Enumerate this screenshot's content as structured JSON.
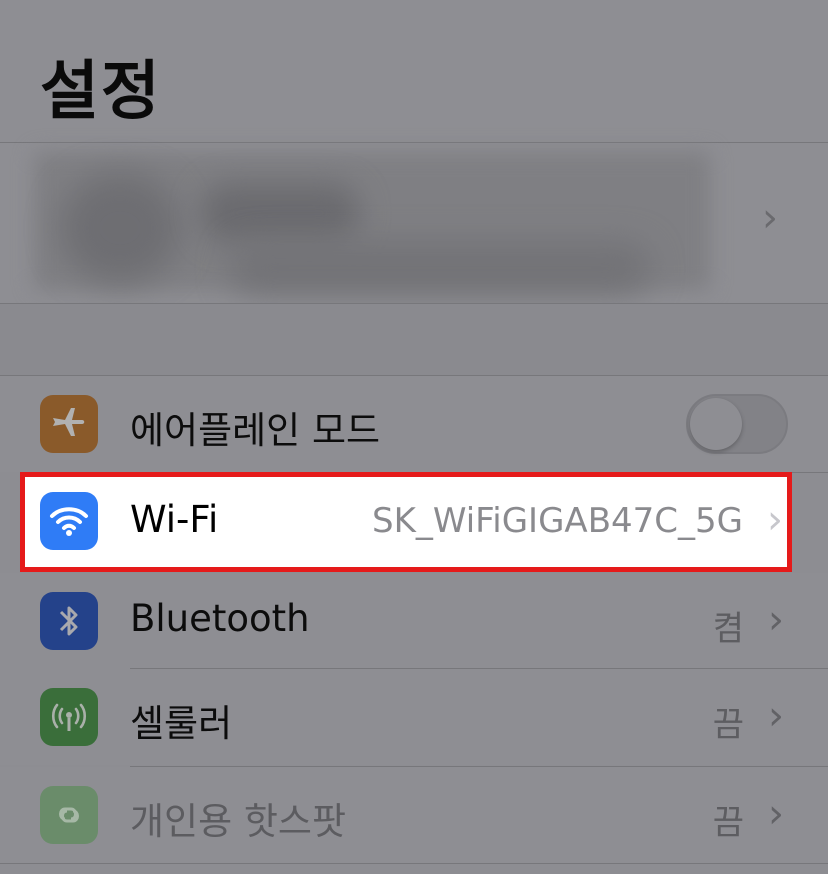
{
  "header": {
    "title": "설정"
  },
  "account": {
    "chevron": "›"
  },
  "settings": {
    "airplane": {
      "label": "에어플레인 모드",
      "icon": "airplane-icon",
      "icon_color": "#8a5a2a",
      "toggle_on": false
    },
    "wifi": {
      "label": "Wi-Fi",
      "value": "SK_WiFiGIGAB47C_5G",
      "icon": "wifi-icon",
      "icon_color": "#2f7cf6",
      "chevron": "›"
    },
    "bluetooth": {
      "label": "Bluetooth",
      "value": "켬",
      "icon": "bluetooth-icon",
      "icon_color": "#24428a",
      "chevron": "›"
    },
    "cellular": {
      "label": "셀룰러",
      "value": "끔",
      "icon": "cellular-icon",
      "icon_color": "#3a6e3a",
      "chevron": "›"
    },
    "hotspot": {
      "label": "개인용 핫스팟",
      "value": "끔",
      "icon": "hotspot-icon",
      "icon_color": "#6a8c6a",
      "chevron": "›"
    }
  },
  "highlight_color": "#e51a1a"
}
